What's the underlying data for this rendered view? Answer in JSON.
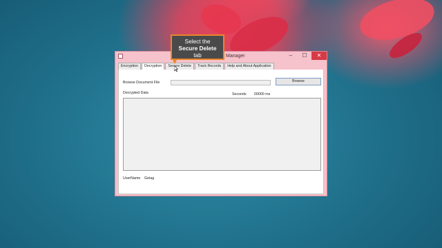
{
  "window": {
    "title_fragment": "Manager",
    "controls": {
      "minimize": "–",
      "maximize": "☐",
      "close": "✕"
    }
  },
  "tabs": [
    {
      "label": "Encryption"
    },
    {
      "label": "Decryption"
    },
    {
      "label": "Secure Delete"
    },
    {
      "label": "Track Records"
    },
    {
      "label": "Help and About Application"
    }
  ],
  "active_tab": "Decryption",
  "decryption_panel": {
    "browse_label": "Browse Document File",
    "file_path_value": "",
    "browse_button": "Browse",
    "decrypted_data_label": "Decrypted Data",
    "seconds_label": "Seconds",
    "seconds_value": "00000 ms",
    "username_label": "UserName",
    "username_value": "Geiag"
  },
  "tooltip": {
    "line1": "Select the",
    "line2": "Secure Delete",
    "line3": "tab"
  },
  "colors": {
    "window_frame": "#f6c2cc",
    "close_button": "#d63a46",
    "tooltip_bg": "#4a4a4a",
    "tooltip_border": "#e8872a",
    "desktop": "#1f6f8a"
  }
}
